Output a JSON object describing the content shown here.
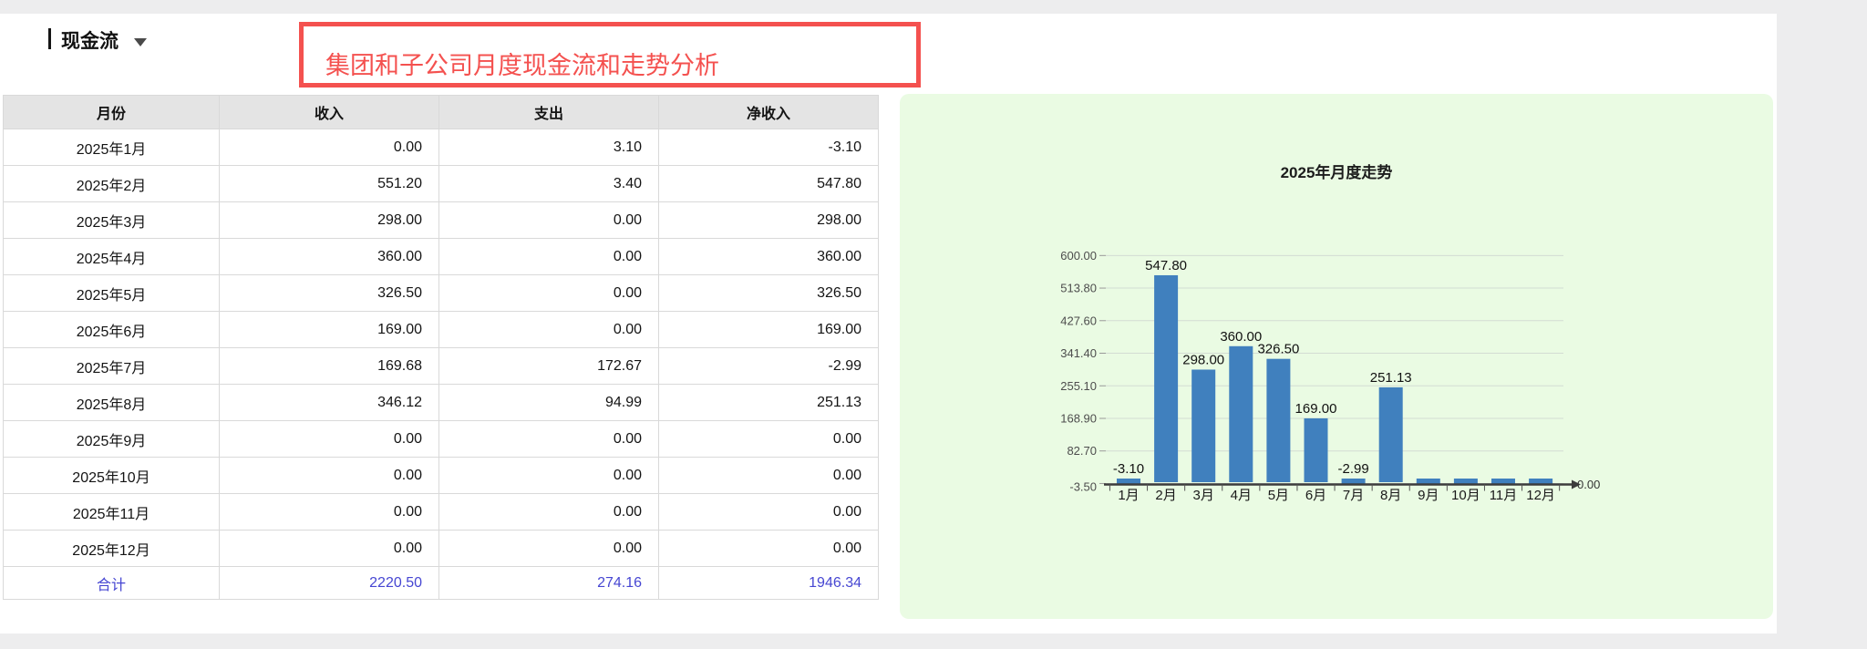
{
  "header": {
    "view_title": "现金流",
    "annotation": "集团和子公司月度现金流和走势分析"
  },
  "table": {
    "columns": [
      "月份",
      "收入",
      "支出",
      "净收入"
    ],
    "rows": [
      {
        "month": "2025年1月",
        "income": "0.00",
        "expense": "3.10",
        "net": "-3.10"
      },
      {
        "month": "2025年2月",
        "income": "551.20",
        "expense": "3.40",
        "net": "547.80"
      },
      {
        "month": "2025年3月",
        "income": "298.00",
        "expense": "0.00",
        "net": "298.00"
      },
      {
        "month": "2025年4月",
        "income": "360.00",
        "expense": "0.00",
        "net": "360.00"
      },
      {
        "month": "2025年5月",
        "income": "326.50",
        "expense": "0.00",
        "net": "326.50"
      },
      {
        "month": "2025年6月",
        "income": "169.00",
        "expense": "0.00",
        "net": "169.00"
      },
      {
        "month": "2025年7月",
        "income": "169.68",
        "expense": "172.67",
        "net": "-2.99"
      },
      {
        "month": "2025年8月",
        "income": "346.12",
        "expense": "94.99",
        "net": "251.13"
      },
      {
        "month": "2025年9月",
        "income": "0.00",
        "expense": "0.00",
        "net": "0.00"
      },
      {
        "month": "2025年10月",
        "income": "0.00",
        "expense": "0.00",
        "net": "0.00"
      },
      {
        "month": "2025年11月",
        "income": "0.00",
        "expense": "0.00",
        "net": "0.00"
      },
      {
        "month": "2025年12月",
        "income": "0.00",
        "expense": "0.00",
        "net": "0.00"
      }
    ],
    "total": {
      "label": "合计",
      "income": "2220.50",
      "expense": "274.16",
      "net": "1946.34"
    }
  },
  "chart_data": {
    "type": "bar",
    "title": "2025年月度走势",
    "categories": [
      "1月",
      "2月",
      "3月",
      "4月",
      "5月",
      "6月",
      "7月",
      "8月",
      "9月",
      "10月",
      "11月",
      "12月"
    ],
    "values": [
      -3.1,
      547.8,
      298.0,
      360.0,
      326.5,
      169.0,
      -2.99,
      251.13,
      0.0,
      0.0,
      0.0,
      0.0
    ],
    "data_labels": [
      "-3.10",
      "547.80",
      "298.00",
      "360.00",
      "326.50",
      "169.00",
      "-2.99",
      "251.13"
    ],
    "end_label": "0.00",
    "y_ticks": [
      "600.00",
      "513.80",
      "427.60",
      "341.40",
      "255.10",
      "168.90",
      "82.70",
      "-3.50"
    ],
    "ylim": [
      -3.5,
      600.0
    ],
    "grid": true,
    "legend": "none",
    "bar_color": "#4080BE",
    "panel_bg": "#EAFBE3"
  },
  "colors": {
    "page_bg": "#EDEDEE",
    "annotation_red": "#F4514F",
    "table_header_bg": "#E4E4E4",
    "table_border": "#D9D9D9",
    "total_blue": "#4646D2",
    "gridline": "#D3DCD3",
    "axis": "#3C3C3C"
  }
}
